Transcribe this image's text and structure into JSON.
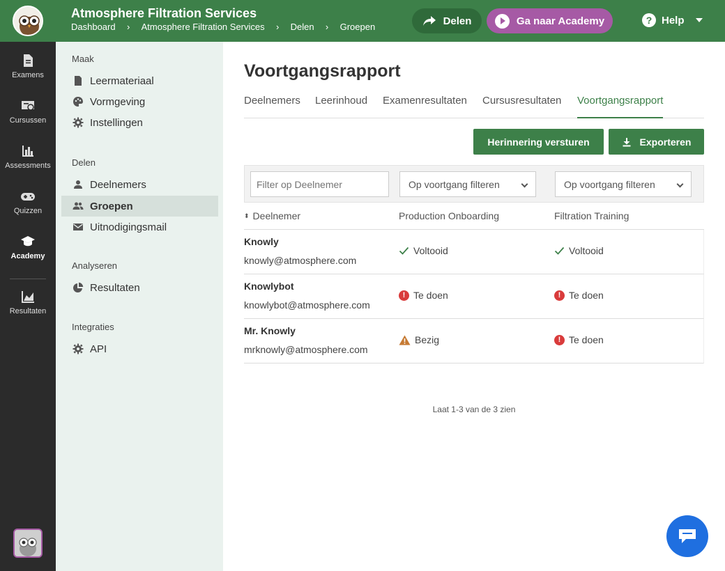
{
  "header": {
    "title": "Atmosphere Filtration Services",
    "breadcrumbs": [
      "Dashboard",
      "Atmosphere Filtration Services",
      "Delen",
      "Groepen"
    ],
    "share_label": "Delen",
    "academy_label": "Ga naar Academy",
    "help_label": "Help",
    "colors": {
      "primary": "#3d8049",
      "academy": "#a65aa5"
    }
  },
  "rail": {
    "items": [
      {
        "label": "Examens",
        "icon": "document-icon"
      },
      {
        "label": "Cursussen",
        "icon": "certificate-icon"
      },
      {
        "label": "Assessments",
        "icon": "bar-chart-icon"
      },
      {
        "label": "Quizzen",
        "icon": "gamepad-icon"
      },
      {
        "label": "Academy",
        "icon": "graduation-cap-icon"
      },
      {
        "label": "Resultaten",
        "icon": "area-chart-icon"
      }
    ]
  },
  "subnav": {
    "sections": [
      "Maak",
      "Delen",
      "Analyseren",
      "Integraties"
    ],
    "maak": [
      "Leermateriaal",
      "Vormgeving",
      "Instellingen"
    ],
    "delen": [
      "Deelnemers",
      "Groepen",
      "Uitnodigingsmail"
    ],
    "analyseren": [
      "Resultaten"
    ],
    "integraties": [
      "API"
    ]
  },
  "main": {
    "title": "Voortgangsrapport",
    "tabs": [
      "Deelnemers",
      "Leerinhoud",
      "Examenresultaten",
      "Cursusresultaten",
      "Voortgangsrapport"
    ],
    "reminder_label": "Herinnering versturen",
    "export_label": "Exporteren",
    "filter_placeholder": "Filter op Deelnemer",
    "progress_filter_1": "Op voortgang filteren",
    "progress_filter_2": "Op voortgang filteren",
    "columns": [
      "Deelnemer",
      "Production Onboarding",
      "Filtration Training"
    ],
    "rows": [
      {
        "name": "Knowly",
        "email": "knowly@atmosphere.com",
        "s1": "Voltooid",
        "s2": "Voltooid"
      },
      {
        "name": "Knowlybot",
        "email": "knowlybot@atmosphere.com",
        "s1": "Te doen",
        "s2": "Te doen"
      },
      {
        "name": "Mr. Knowly",
        "email": "mrknowly@atmosphere.com",
        "s1": "Bezig",
        "s2": "Te doen"
      }
    ],
    "paging": "Laat 1-3 van de 3 zien"
  }
}
